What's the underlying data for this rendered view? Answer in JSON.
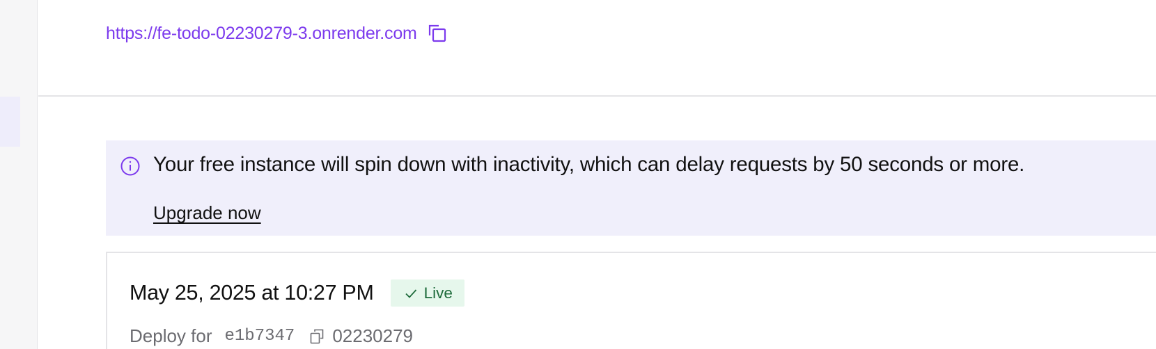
{
  "service": {
    "url": "https://fe-todo-02230279-3.onrender.com",
    "url_copy_icon": "copy-icon"
  },
  "notice": {
    "icon": "info-icon",
    "message": "Your free instance will spin down with inactivity, which can delay requests by 50 seconds or more.",
    "upgrade_label": "Upgrade now"
  },
  "deploy": {
    "date": "May 25, 2025 at 10:27 PM",
    "status": "Live",
    "status_icon": "check-icon",
    "deploy_for_label": "Deploy for",
    "commit_hash": "e1b7347",
    "commit_copy_icon": "copy-icon",
    "commit_message": "02230279"
  },
  "colors": {
    "accent": "#7c3aed",
    "notice_bg": "#f0effb",
    "live_bg": "#e6f7ec",
    "live_text": "#1e6b3b",
    "divider": "#e4e4e7"
  }
}
